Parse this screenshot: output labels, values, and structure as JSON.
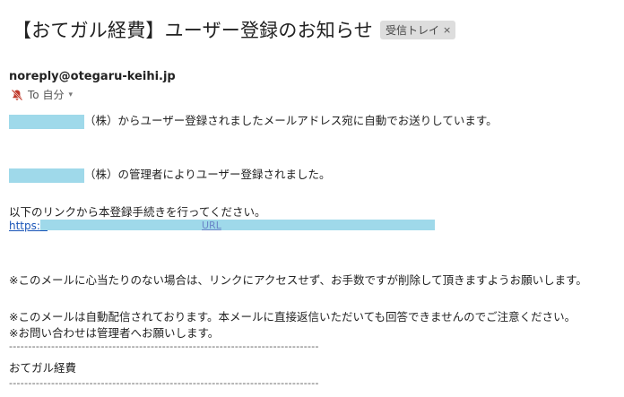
{
  "subject": "【おてガル経費】ユーザー登録のお知らせ",
  "label_chip": {
    "text": "受信トレイ",
    "close": "×"
  },
  "sender": "noreply@otegaru-keihi.jp",
  "recipient": {
    "text": "To 自分",
    "caret": "▾"
  },
  "body": {
    "line1_suffix": "（株）からユーザー登録されましたメールアドレス宛に自動でお送りしています。",
    "line2_suffix": "（株）の管理者によりユーザー登録されました。",
    "line3": "以下のリンクから本登録手続きを行ってください。",
    "link_prefix": "https://",
    "link_mid": "URL",
    "notice1": "※このメールに心当たりのない場合は、リンクにアクセスせず、お手数ですが削除して頂きますようお願いします。",
    "notice2": "※このメールは自動配信されております。本メールに直接返信いただいても回答できませんのでご注意ください。",
    "notice3": "※お問い合わせは管理者へお願いします。",
    "divider": "----------------------------------------------------------------------------------------------------",
    "signature": "おてガル経費"
  },
  "colors": {
    "redaction": "#9fd9ea",
    "link": "#1a55b8",
    "chip_bg": "#dddddd"
  },
  "icons": {
    "recipient": "notifications-off-icon",
    "chip_close": "close-icon",
    "dropdown": "chevron-down-icon"
  }
}
